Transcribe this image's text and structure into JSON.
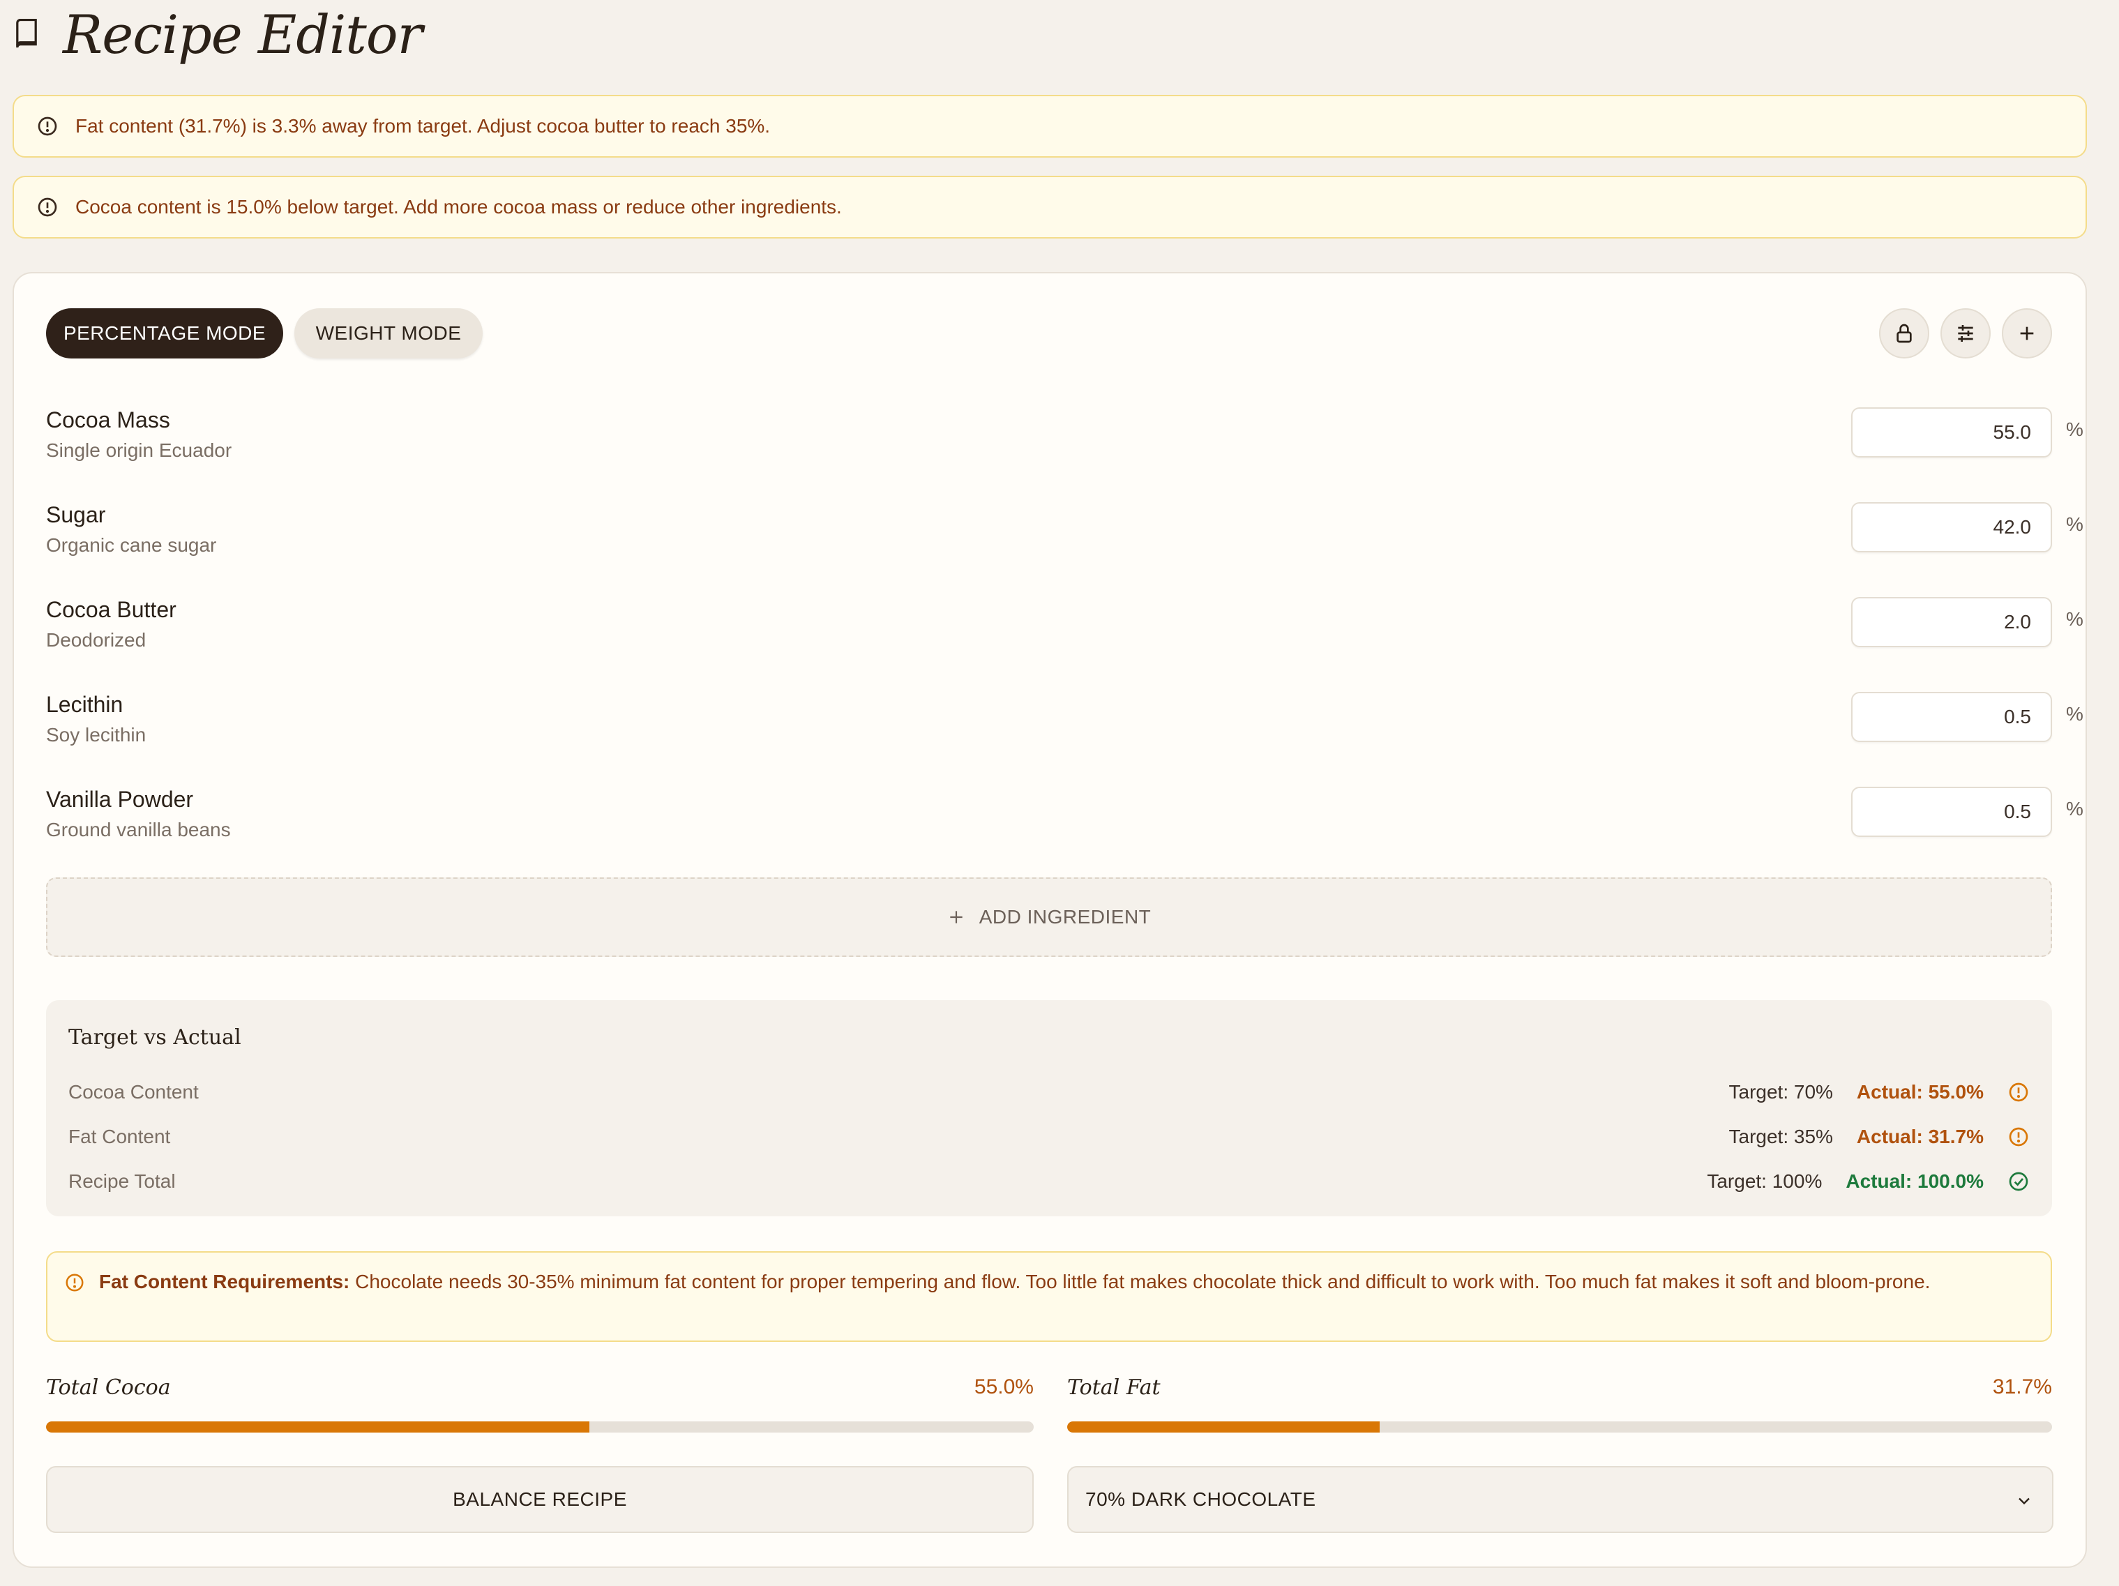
{
  "header": {
    "title": "Recipe Editor",
    "icon": "book-icon"
  },
  "alerts": [
    {
      "text": "Fat content (31.7%) is 3.3% away from target. Adjust cocoa butter to reach 35%."
    },
    {
      "text": "Cocoa content is 15.0% below target. Add more cocoa mass or reduce other ingredients."
    }
  ],
  "toolbar": {
    "percentage_mode_label": "PERCENTAGE MODE",
    "weight_mode_label": "WEIGHT MODE",
    "active_mode": "percentage",
    "icons": [
      "lock-icon",
      "sliders-icon",
      "plus-icon"
    ]
  },
  "ingredients": [
    {
      "name": "Cocoa Mass",
      "description": "Single origin Ecuador",
      "value": "55.0",
      "unit": "%"
    },
    {
      "name": "Sugar",
      "description": "Organic cane sugar",
      "value": "42.0",
      "unit": "%"
    },
    {
      "name": "Cocoa Butter",
      "description": "Deodorized",
      "value": "2.0",
      "unit": "%"
    },
    {
      "name": "Lecithin",
      "description": "Soy lecithin",
      "value": "0.5",
      "unit": "%"
    },
    {
      "name": "Vanilla Powder",
      "description": "Ground vanilla beans",
      "value": "0.5",
      "unit": "%"
    }
  ],
  "add_ingredient_label": "ADD INGREDIENT",
  "target_vs_actual": {
    "title": "Target vs Actual",
    "rows": [
      {
        "label": "Cocoa Content",
        "target": "Target: 70%",
        "actual": "Actual: 55.0%",
        "status": "warning"
      },
      {
        "label": "Fat Content",
        "target": "Target: 35%",
        "actual": "Actual: 31.7%",
        "status": "warning"
      },
      {
        "label": "Recipe Total",
        "target": "Target: 100%",
        "actual": "Actual: 100.0%",
        "status": "ok"
      }
    ]
  },
  "info": {
    "heading": "Fat Content Requirements:",
    "text": "Chocolate needs 30-35% minimum fat content for proper tempering and flow. Too little fat makes chocolate thick and difficult to work with. Too much fat makes it soft and bloom-prone."
  },
  "progress": {
    "cocoa": {
      "label": "Total Cocoa",
      "value_text": "55.0%",
      "fraction": 0.55
    },
    "fat": {
      "label": "Total Fat",
      "value_text": "31.7%",
      "fraction": 0.317
    }
  },
  "actions": {
    "balance_label": "BALANCE RECIPE",
    "preset_selected": "70% DARK CHOCOLATE"
  },
  "colors": {
    "accent": "#d97706",
    "warning_text": "#b0520e",
    "ok_text": "#1d7a3c",
    "alert_bg": "#fffbea",
    "dark_button": "#2f2119"
  }
}
